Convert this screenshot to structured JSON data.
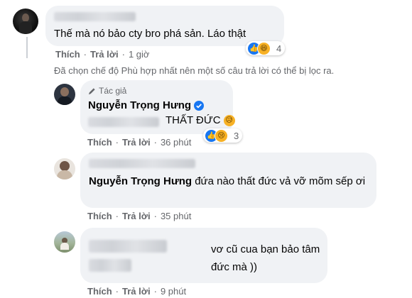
{
  "comments": [
    {
      "text": "Thế mà nó bảo cty bro phá sản. Láo thật",
      "reaction_count": "4",
      "like_label": "Thích",
      "reply_label": "Trả lời",
      "time": "1 giờ"
    },
    {
      "author_badge": "Tác giả",
      "author": "Nguyễn Trọng Hưng",
      "text": "THẤT ĐỨC",
      "reaction_count": "3",
      "like_label": "Thích",
      "reply_label": "Trả lời",
      "time": "36 phút"
    },
    {
      "mention": "Nguyễn Trọng Hưng",
      "text": "đứa nào thất đức vả vỡ mõm sếp ơi",
      "like_label": "Thích",
      "reply_label": "Trả lời",
      "time": "35 phút"
    },
    {
      "text": "vơ cũ cua bạn bảo tâm đức mà ))",
      "like_label": "Thích",
      "reply_label": "Trả lời",
      "time": "9 phút"
    }
  ],
  "filter_notice": "Đã chọn chế độ Phù hợp nhất nên một số câu trả lời có thể bị lọc ra.",
  "colors": {
    "bubble": "#f0f2f5",
    "meta": "#65676b",
    "like_blue": "#1877f2",
    "verified": "#1877f2"
  },
  "icons": [
    "pen-icon",
    "verified-badge-icon",
    "like-reaction-icon",
    "haha-reaction-icon",
    "sad-reaction-icon"
  ]
}
